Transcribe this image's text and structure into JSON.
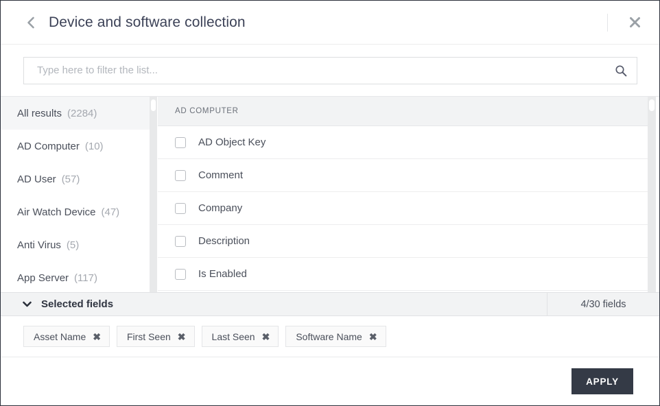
{
  "header": {
    "title": "Device and software collection",
    "back_icon": "chevron-left-icon",
    "close_icon": "close-icon"
  },
  "search": {
    "placeholder": "Type here to filter the list...",
    "value": "",
    "icon": "search-icon"
  },
  "sidebar": {
    "items": [
      {
        "label": "All results",
        "count": "(2284)",
        "active": true
      },
      {
        "label": "AD Computer",
        "count": "(10)",
        "active": false
      },
      {
        "label": "AD User",
        "count": "(57)",
        "active": false
      },
      {
        "label": "Air Watch Device",
        "count": "(47)",
        "active": false
      },
      {
        "label": "Anti Virus",
        "count": "(5)",
        "active": false
      },
      {
        "label": "App Server",
        "count": "(117)",
        "active": false
      }
    ]
  },
  "main": {
    "group_header": "AD COMPUTER",
    "fields": [
      {
        "label": "AD Object Key",
        "checked": false
      },
      {
        "label": "Comment",
        "checked": false
      },
      {
        "label": "Company",
        "checked": false
      },
      {
        "label": "Description",
        "checked": false
      },
      {
        "label": "Is Enabled",
        "checked": false
      }
    ]
  },
  "selected_bar": {
    "title": "Selected fields",
    "chevron_icon": "chevron-down-icon",
    "count_label": "4/30 fields"
  },
  "chips": [
    {
      "label": "Asset Name",
      "remove_icon": "close-icon"
    },
    {
      "label": "First Seen",
      "remove_icon": "close-icon"
    },
    {
      "label": "Last Seen",
      "remove_icon": "close-icon"
    },
    {
      "label": "Software Name",
      "remove_icon": "close-icon"
    }
  ],
  "footer": {
    "apply_label": "APPLY"
  },
  "colors": {
    "accent_dark": "#343a46",
    "panel_grey": "#f2f3f4",
    "text": "#4a4f5a",
    "muted": "#a4a8af"
  }
}
